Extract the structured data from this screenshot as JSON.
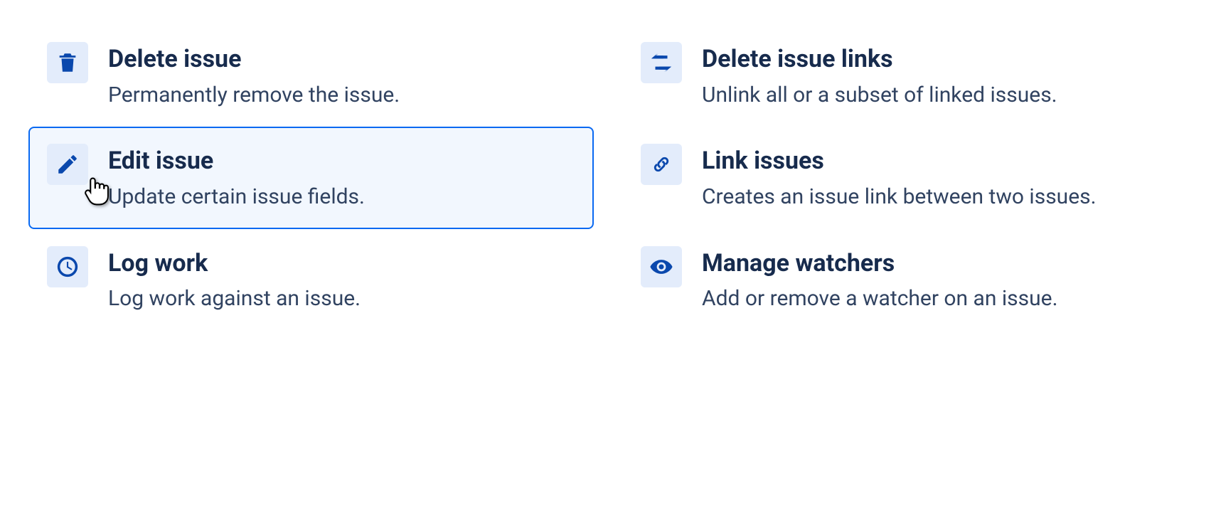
{
  "options": {
    "deleteIssue": {
      "title": "Delete issue",
      "desc": "Permanently remove the issue."
    },
    "editIssue": {
      "title": "Edit issue",
      "desc": "Update certain issue fields."
    },
    "logWork": {
      "title": "Log work",
      "desc": "Log work against an issue."
    },
    "deleteIssueLinks": {
      "title": "Delete issue links",
      "desc": "Unlink all or a subset of linked issues."
    },
    "linkIssues": {
      "title": "Link issues",
      "desc": "Creates an issue link between two issues."
    },
    "manageWatchers": {
      "title": "Manage watchers",
      "desc": "Add or remove a watcher on an issue."
    }
  }
}
